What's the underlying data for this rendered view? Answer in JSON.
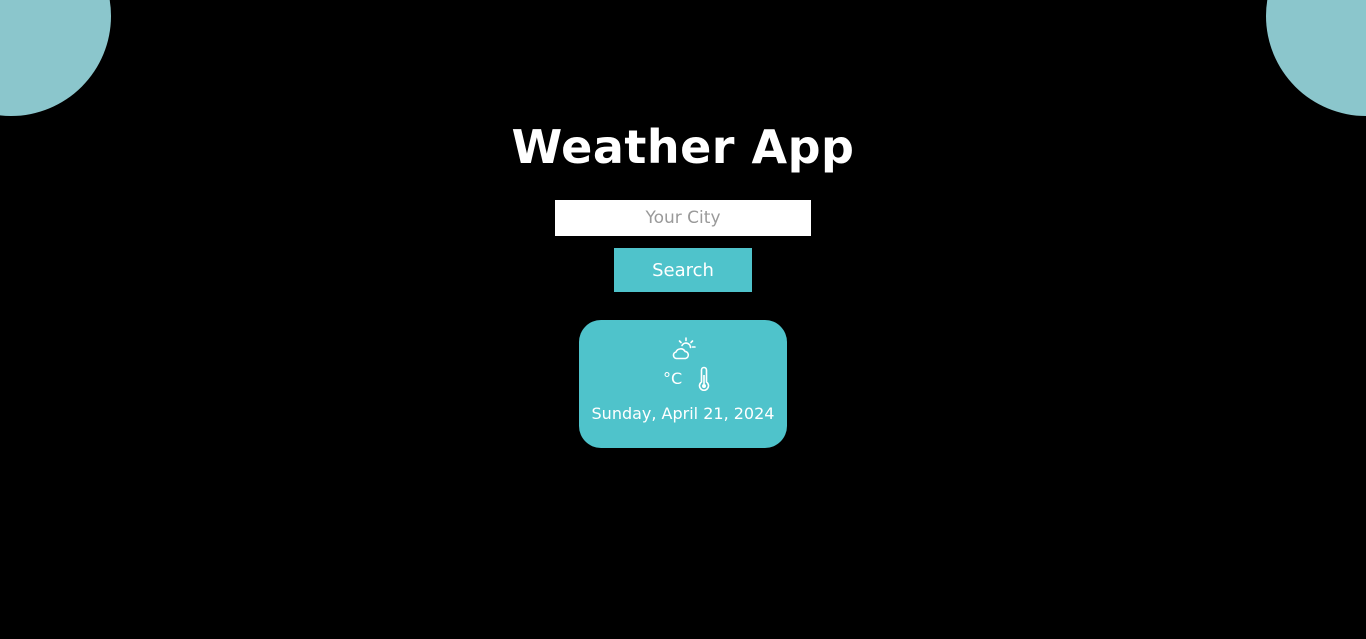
{
  "app": {
    "title": "Weather App"
  },
  "search": {
    "placeholder": "Your City",
    "value": "",
    "button_label": "Search"
  },
  "weather_card": {
    "icon": "cloud-sun-icon",
    "temperature": "",
    "unit": "°C",
    "thermometer_icon": "thermometer-icon",
    "date": "Sunday, April 21, 2024"
  },
  "colors": {
    "background": "#000000",
    "accent": "#4fc3cb",
    "corner_circles": "#8bc6cc",
    "text": "#ffffff"
  }
}
